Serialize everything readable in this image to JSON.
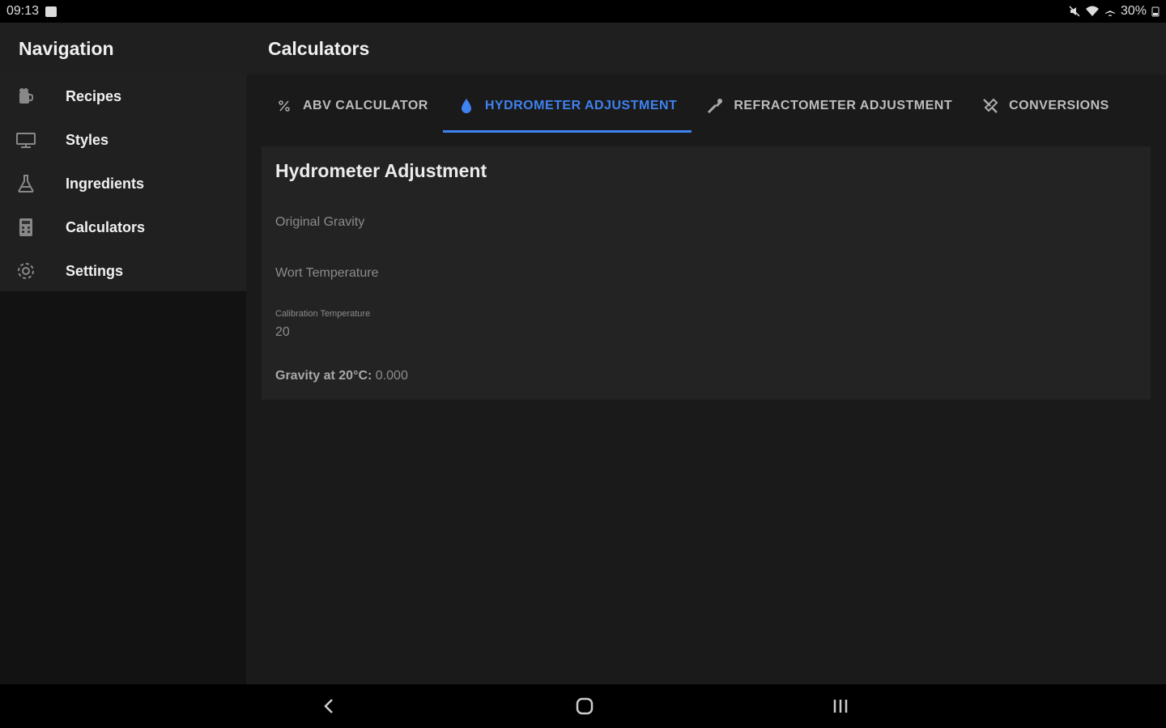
{
  "status": {
    "time": "09:13",
    "battery": "30%"
  },
  "sidebar": {
    "title": "Navigation",
    "items": [
      {
        "label": "Recipes",
        "icon": "beer-icon"
      },
      {
        "label": "Styles",
        "icon": "display-icon"
      },
      {
        "label": "Ingredients",
        "icon": "flask-icon"
      },
      {
        "label": "Calculators",
        "icon": "calculator-icon"
      },
      {
        "label": "Settings",
        "icon": "gear-icon"
      }
    ]
  },
  "main": {
    "title": "Calculators",
    "tabs": [
      {
        "label": "ABV CALCULATOR",
        "icon": "percent-icon",
        "active": false
      },
      {
        "label": "HYDROMETER ADJUSTMENT",
        "icon": "drop-icon",
        "active": true
      },
      {
        "label": "REFRACTOMETER ADJUSTMENT",
        "icon": "eyedropper-icon",
        "active": false
      },
      {
        "label": "CONVERSIONS",
        "icon": "tools-icon",
        "active": false
      }
    ],
    "card": {
      "title": "Hydrometer Adjustment",
      "original_gravity_placeholder": "Original Gravity",
      "wort_temp_placeholder": "Wort Temperature",
      "calibration_label": "Calibration Temperature",
      "calibration_value": "20",
      "result_label": "Gravity at 20°C:",
      "result_value": "0.000"
    }
  },
  "colors": {
    "accent": "#3f82f0",
    "background": "#121212",
    "card": "#232323"
  }
}
